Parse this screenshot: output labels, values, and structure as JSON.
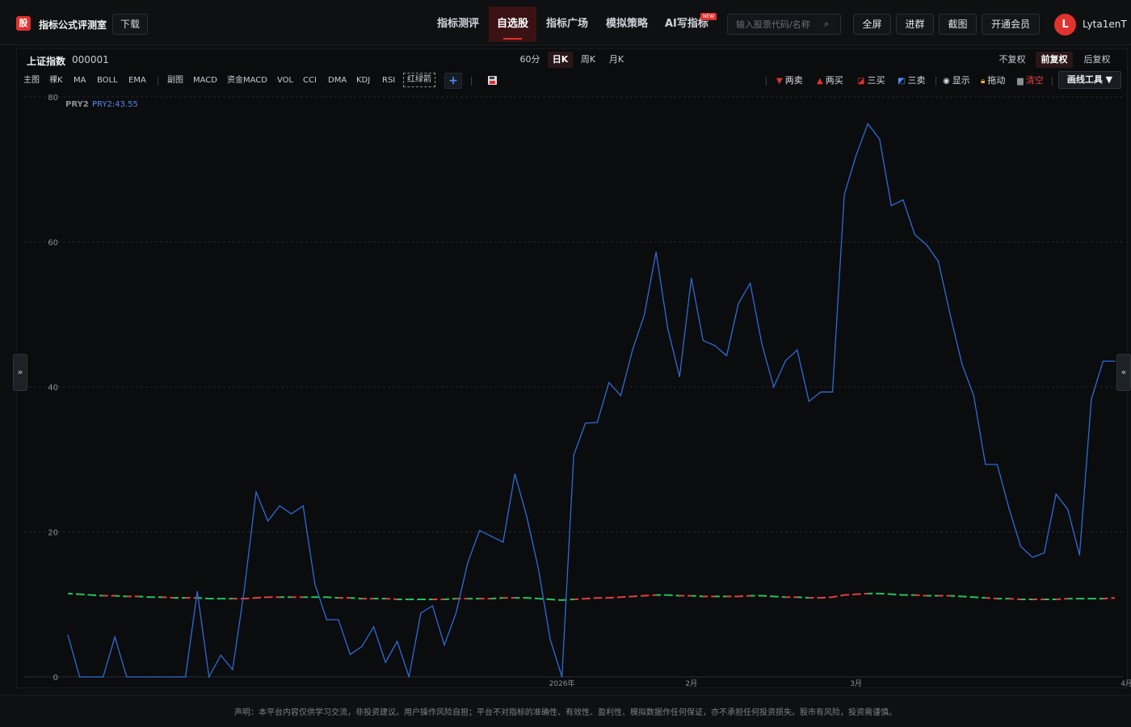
{
  "header": {
    "logo_char": "股",
    "site_name": "指标公式评测室",
    "download_label": "下载",
    "nav": [
      "指标测评",
      "自选股",
      "指标广场",
      "模拟策略",
      "AI写指标"
    ],
    "new_badge": "NEW",
    "search_placeholder": "输入股票代码/名称",
    "buttons": [
      "全屏",
      "进群",
      "截图",
      "开通会员"
    ],
    "avatar_letter": "L",
    "username": "Lyta1enT"
  },
  "stock": {
    "name": "上证指数",
    "code": "000001"
  },
  "periods": [
    "60分",
    "日K",
    "周K",
    "月K"
  ],
  "adjustments": [
    "不复权",
    "前复权",
    "后复权"
  ],
  "indicators": {
    "main_label": "主图",
    "main": [
      "裸K",
      "MA",
      "BOLL",
      "EMA"
    ],
    "sub_label": "副图",
    "sub": [
      "MACD",
      "资金MACD",
      "VOL",
      "CCI",
      "DMA",
      "KDJ",
      "RSI"
    ],
    "selected": "红绿箭",
    "add_symbol": "+"
  },
  "tools": {
    "sell2": "两卖",
    "buy2": "两买",
    "buy3": "三买",
    "sell3": "三卖",
    "show": "显示",
    "drag": "拖动",
    "clear": "清空",
    "draw": "画线工具 ▼"
  },
  "side_toggle": {
    "left": "»",
    "right": "«"
  },
  "colors": {
    "accent": "#e0322f",
    "line": "#2e6bd6",
    "up": "#e04040",
    "down": "#22c55e",
    "label_blue": "#4a8cf0"
  },
  "chart_data": {
    "type": "line",
    "series_label": "PRY2",
    "series_value_label": "PRY2:43.55",
    "yticks": [
      "80",
      "60",
      "40",
      "20",
      "0"
    ],
    "ylim": [
      0,
      80
    ],
    "xticks": [
      {
        "label": "2026年",
        "index": 42
      },
      {
        "label": "2月",
        "index": 53
      },
      {
        "label": "3月",
        "index": 67
      },
      {
        "label": "4月",
        "index": 90
      }
    ],
    "series": [
      {
        "name": "PRY2",
        "values": [
          5.8,
          0,
          0,
          0,
          5.5,
          0,
          0,
          0,
          0,
          0,
          0,
          11.8,
          0,
          3.0,
          1.0,
          12.0,
          25.5,
          21.5,
          23.6,
          22.5,
          23.6,
          12.8,
          7.9,
          7.9,
          3.1,
          4.2,
          6.9,
          2.0,
          4.9,
          0,
          8.8,
          9.8,
          4.4,
          8.8,
          15.8,
          20.2,
          19.4,
          18.6,
          28.0,
          22.2,
          14.9,
          5.2,
          0,
          30.6,
          35.0,
          35.1,
          40.6,
          38.8,
          45.1,
          49.9,
          58.6,
          48.0,
          41.4,
          55.0,
          46.4,
          45.7,
          44.3,
          51.5,
          54.3,
          45.9,
          40.0,
          43.6,
          45.1,
          38.0,
          39.3,
          39.3,
          66.5,
          71.9,
          76.3,
          74.2,
          65.0,
          65.8,
          61.0,
          59.6,
          57.3,
          50.0,
          43.2,
          38.8,
          29.3,
          29.3,
          23.3,
          18.0,
          16.5,
          17.1,
          25.2,
          23.1,
          16.8,
          38.3,
          43.55,
          43.55
        ]
      },
      {
        "name": "red-green",
        "values": [
          11.5,
          11.4,
          11.3,
          11.2,
          11.2,
          11.1,
          11.1,
          11.0,
          11.0,
          10.9,
          10.9,
          10.9,
          10.8,
          10.8,
          10.8,
          10.8,
          10.9,
          11.0,
          11.0,
          11.0,
          11.0,
          11.0,
          11.0,
          10.9,
          10.9,
          10.8,
          10.8,
          10.8,
          10.7,
          10.7,
          10.7,
          10.7,
          10.7,
          10.8,
          10.8,
          10.8,
          10.8,
          10.9,
          10.9,
          10.9,
          10.8,
          10.7,
          10.6,
          10.7,
          10.8,
          10.9,
          10.9,
          11.0,
          11.1,
          11.2,
          11.3,
          11.3,
          11.2,
          11.2,
          11.1,
          11.1,
          11.1,
          11.1,
          11.2,
          11.2,
          11.1,
          11.0,
          11.0,
          10.9,
          10.9,
          11.0,
          11.3,
          11.4,
          11.5,
          11.5,
          11.4,
          11.3,
          11.3,
          11.2,
          11.2,
          11.2,
          11.1,
          11.0,
          10.9,
          10.8,
          10.8,
          10.7,
          10.7,
          10.7,
          10.7,
          10.8,
          10.8,
          10.8,
          10.8,
          10.9,
          11.0,
          11.0
        ],
        "colors": [
          "down",
          "down",
          "down",
          "up",
          "down",
          "up",
          "down",
          "down",
          "up",
          "down",
          "up",
          "down",
          "down",
          "down",
          "up",
          "up",
          "up",
          "up",
          "down",
          "up",
          "down",
          "down",
          "down",
          "up",
          "down",
          "up",
          "down",
          "up",
          "down",
          "down",
          "down",
          "up",
          "down",
          "up",
          "down",
          "up",
          "down",
          "up",
          "down",
          "down",
          "down",
          "down",
          "down",
          "up",
          "up",
          "up",
          "up",
          "up",
          "up",
          "up",
          "down",
          "down",
          "up",
          "down",
          "up",
          "down",
          "up",
          "up",
          "down",
          "down",
          "down",
          "up",
          "down",
          "up",
          "up",
          "up",
          "up",
          "up",
          "down",
          "down",
          "down",
          "down",
          "up",
          "down",
          "up",
          "down",
          "down",
          "down",
          "up",
          "down",
          "up",
          "down",
          "up",
          "down",
          "up",
          "down",
          "down",
          "down",
          "up",
          "up",
          "up",
          "up"
        ]
      }
    ]
  },
  "footer": "声明：本平台内容仅供学习交流，非投资建议。用户操作风险自担；平台不对指标的准确性、有效性、盈利性、模拟数据作任何保证，亦不承担任何投资损失。股市有风险，投资需谨慎。"
}
